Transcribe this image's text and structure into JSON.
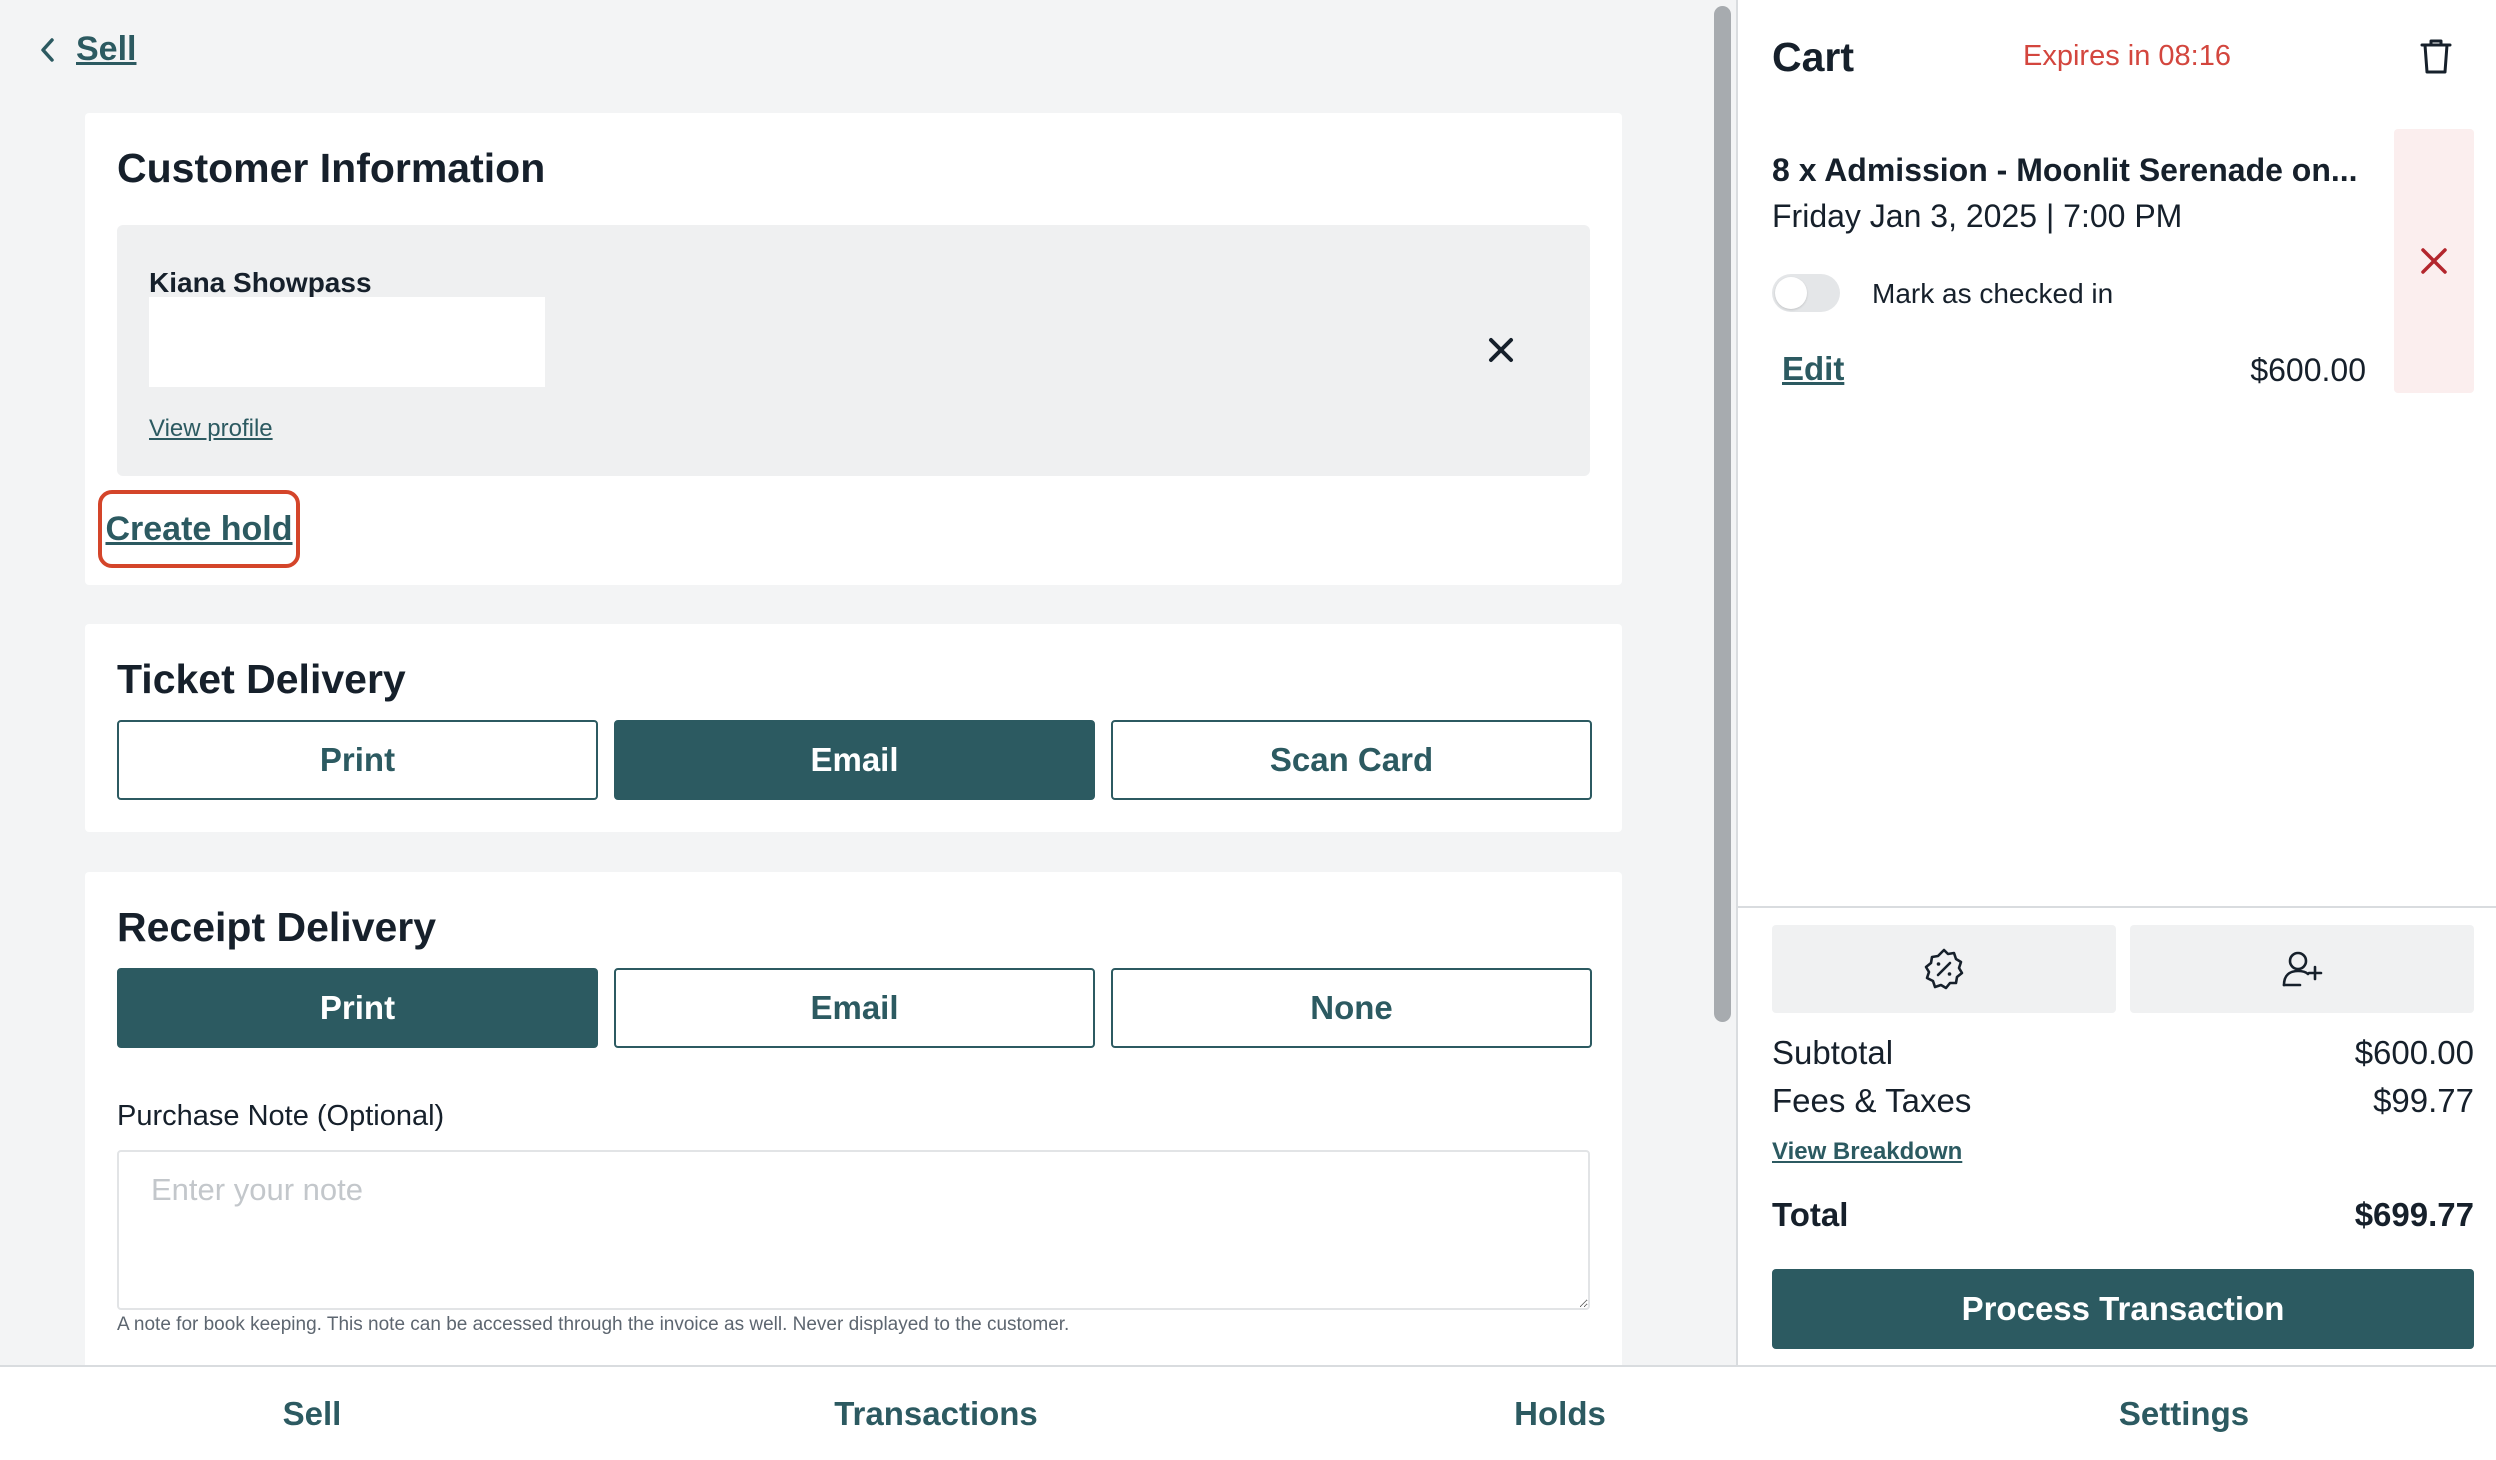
{
  "header": {
    "back_label": "Sell"
  },
  "customer": {
    "title": "Customer Information",
    "name": "Kiana Showpass",
    "field_value": "",
    "view_profile": "View profile",
    "create_hold": "Create hold"
  },
  "ticket_delivery": {
    "title": "Ticket Delivery",
    "options": [
      "Print",
      "Email",
      "Scan Card"
    ],
    "selected": "Email"
  },
  "receipt_delivery": {
    "title": "Receipt Delivery",
    "options": [
      "Print",
      "Email",
      "None"
    ],
    "selected": "Print",
    "note_label": "Purchase Note (Optional)",
    "note_placeholder": "Enter your note",
    "note_value": "",
    "note_help": "A note for book keeping. This note can be accessed through the invoice as well. Never displayed to the customer."
  },
  "cart": {
    "title": "Cart",
    "expires": "Expires in 08:16",
    "item": {
      "title": "8 x Admission - Moonlit Serenade on...",
      "date": "Friday Jan 3, 2025 | 7:00 PM",
      "checked_in_label": "Mark as checked in",
      "checked_in": false,
      "edit": "Edit",
      "price": "$600.00"
    },
    "subtotal_label": "Subtotal",
    "subtotal": "$600.00",
    "fees_label": "Fees & Taxes",
    "fees": "$99.77",
    "view_breakdown": "View Breakdown",
    "total_label": "Total",
    "total": "$699.77",
    "process_label": "Process Transaction"
  },
  "nav": {
    "items": [
      "Sell",
      "Transactions",
      "Holds",
      "Settings"
    ]
  },
  "colors": {
    "primary": "#2c5a61",
    "alert": "#d3463e",
    "highlight": "#d4452a",
    "remove_bg": "#fbeeee"
  },
  "icons": {
    "back": "chevron-left-icon",
    "remove_customer": "close-icon",
    "trash": "trash-icon",
    "remove_item": "close-icon",
    "discount": "discount-badge-icon",
    "add_customer": "user-plus-icon"
  }
}
